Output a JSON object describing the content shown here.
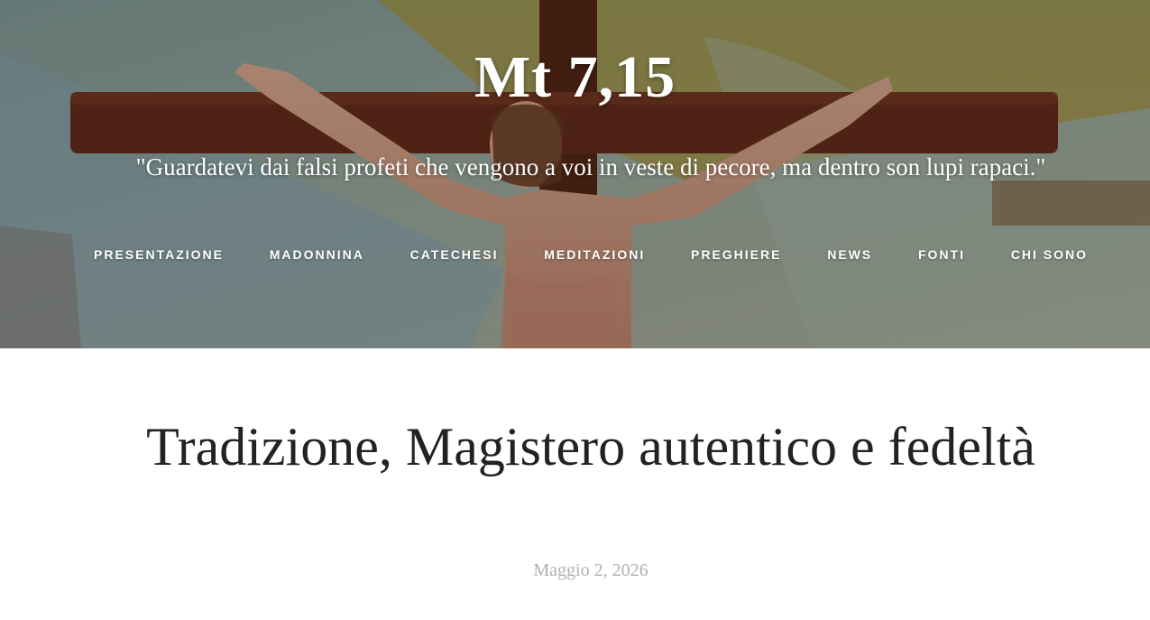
{
  "header": {
    "site_title": "Mt 7,15",
    "tagline": "\"Guardatevi dai falsi profeti che vengono a voi in veste di pecore, ma dentro son lupi rapaci.\"",
    "hero_image_icon": "crucifix-image"
  },
  "nav": {
    "items": [
      {
        "label": "PRESENTAZIONE"
      },
      {
        "label": "MADONNINA"
      },
      {
        "label": "CATECHESI"
      },
      {
        "label": "MEDITAZIONI"
      },
      {
        "label": "PREGHIERE"
      },
      {
        "label": "NEWS"
      },
      {
        "label": "FONTI"
      },
      {
        "label": "CHI SONO"
      }
    ]
  },
  "post": {
    "title": "Tradizione, Magistero autentico e fedeltà",
    "date": "Maggio 2, 2026"
  },
  "colors": {
    "header_text": "#ffffff",
    "title_text": "#222222",
    "date_text": "#b0b0b0"
  }
}
